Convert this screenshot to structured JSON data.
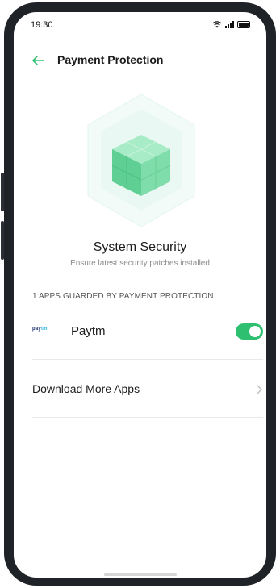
{
  "status_bar": {
    "time": "19:30",
    "icons": [
      "wifi-icon",
      "signal-icon",
      "battery-icon"
    ]
  },
  "header": {
    "title": "Payment Protection",
    "back_icon": "arrow-left-icon"
  },
  "hero": {
    "illustration": "security-cube-icon",
    "title": "System Security",
    "subtitle": "Ensure latest security patches installed"
  },
  "section": {
    "title": "1 APPS GUARDED BY PAYMENT PROTECTION"
  },
  "apps": [
    {
      "logo_text_a": "pay",
      "logo_text_b": "tm",
      "name": "Paytm",
      "enabled": true
    }
  ],
  "download_more": {
    "label": "Download More Apps",
    "icon": "chevron-right-icon"
  },
  "colors": {
    "accent": "#2fbf71",
    "cube": "#6fd9a6"
  }
}
